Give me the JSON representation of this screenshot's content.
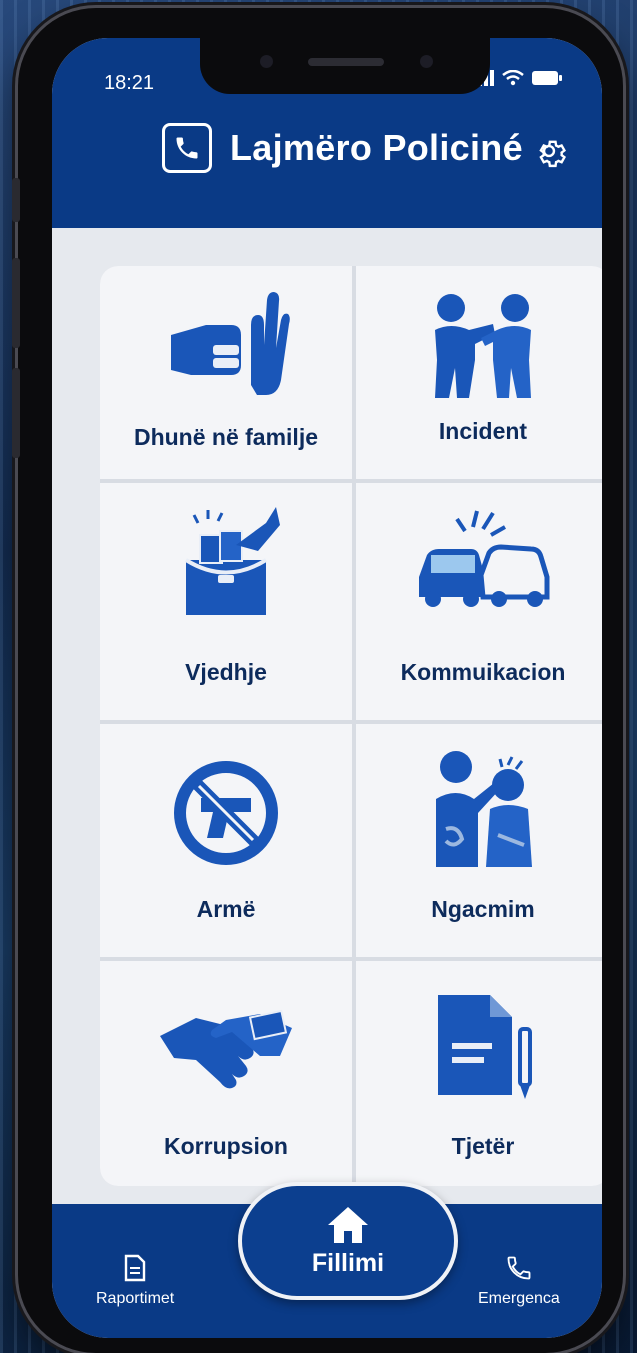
{
  "status_bar": {
    "time": "18:21"
  },
  "header": {
    "title": "Lajmëro Policiné"
  },
  "categories": [
    {
      "label": "Dhunë në familje",
      "icon": "hand-stop-icon"
    },
    {
      "label": "Incident",
      "icon": "fight-icon"
    },
    {
      "label": "Vjedhje",
      "icon": "theft-bag-icon"
    },
    {
      "label": "Kommuikacion",
      "icon": "car-crash-icon"
    },
    {
      "label": "Armë",
      "icon": "no-weapon-icon"
    },
    {
      "label": "Ngacmim",
      "icon": "harassment-icon"
    },
    {
      "label": "Korrupsion",
      "icon": "handshake-bribe-icon"
    },
    {
      "label": "Tjetër",
      "icon": "document-pen-icon"
    }
  ],
  "bottom_nav": {
    "reports": "Raportimet",
    "home": "Fillimi",
    "emergency": "Emergenca"
  },
  "colors": {
    "primary": "#0a3a86",
    "icon_blue": "#1a56b8",
    "label": "#0d2b5c"
  }
}
